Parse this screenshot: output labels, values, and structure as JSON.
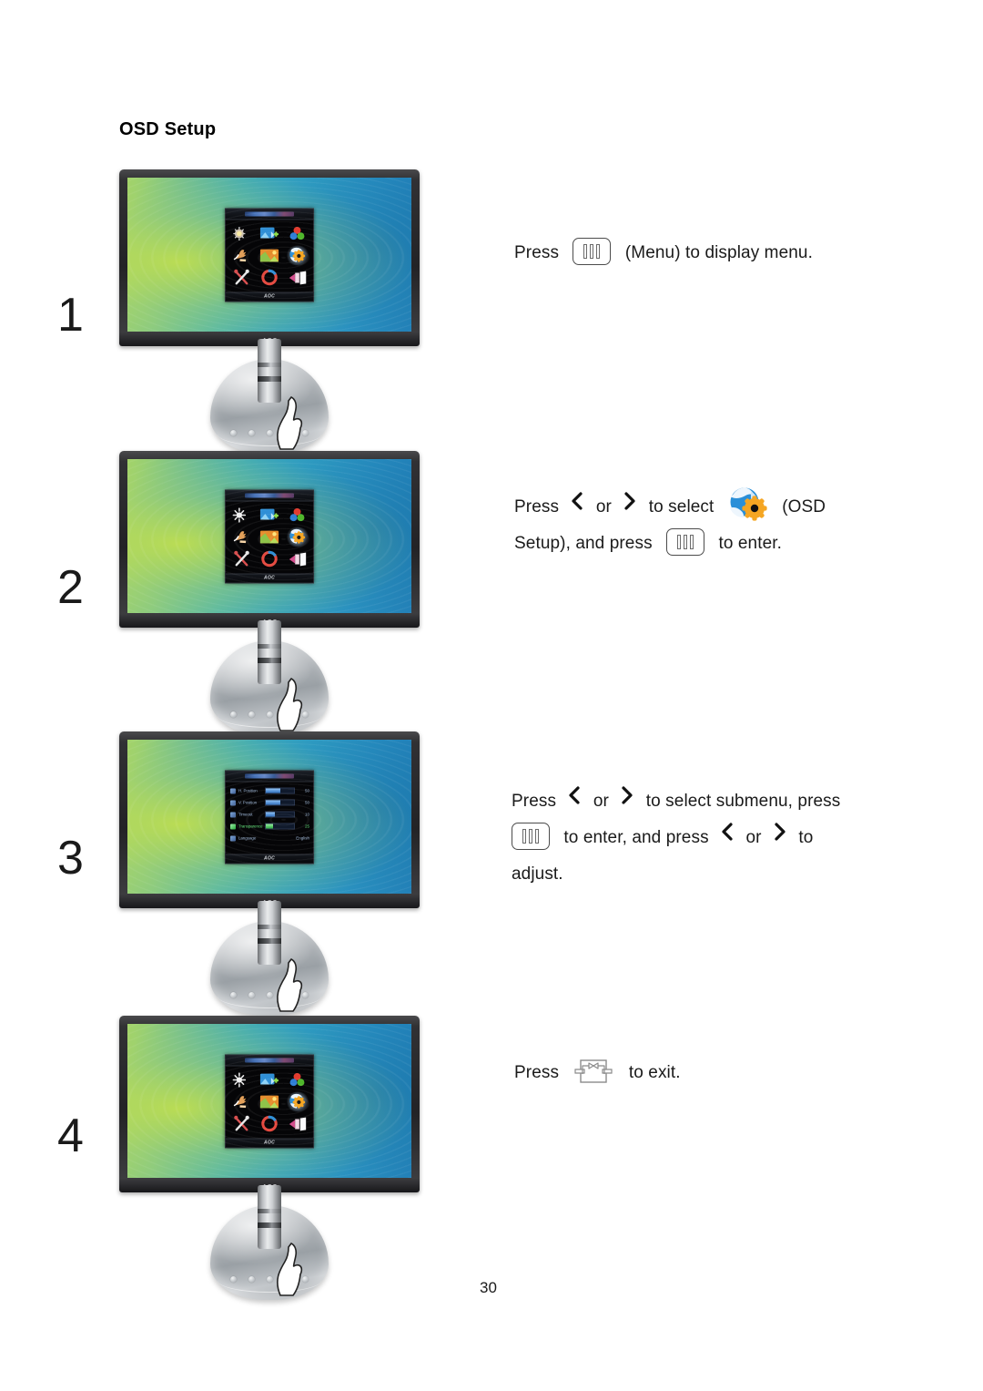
{
  "document": {
    "title": "OSD Setup",
    "page_number": "30"
  },
  "monitor": {
    "brand_logo": "AOC",
    "osd_logo": "AOC"
  },
  "osd_menu": {
    "icons": [
      {
        "name": "brightness-contrast-icon",
        "label": "Luminance"
      },
      {
        "name": "image-setup-icon",
        "label": "Image Setup"
      },
      {
        "name": "color-setup-icon",
        "label": "Color Setup"
      },
      {
        "name": "picture-boost-icon",
        "label": "Picture Boost"
      },
      {
        "name": "picture-in-picture-icon",
        "label": "PIP Setting"
      },
      {
        "name": "osd-setup-globe-gear-icon",
        "label": "OSD Setup"
      },
      {
        "name": "extra-tools-icon",
        "label": "Extra"
      },
      {
        "name": "reset-icon",
        "label": "Reset"
      },
      {
        "name": "exit-icon",
        "label": "Exit"
      }
    ],
    "submenu_rows": [
      {
        "label": "H. Position",
        "value": "50",
        "fill": 50,
        "active": false
      },
      {
        "label": "V. Position",
        "value": "50",
        "fill": 50,
        "active": false
      },
      {
        "label": "Timeout",
        "value": "10",
        "fill": 32,
        "active": false
      },
      {
        "label": "Transparence",
        "value": "25",
        "fill": 25,
        "active": true
      },
      {
        "label": "Language",
        "value": "English",
        "fill": 0,
        "active": false
      }
    ]
  },
  "steps": [
    {
      "number": "1",
      "lines": [
        {
          "parts": [
            {
              "type": "text",
              "value": "Press "
            },
            {
              "type": "key",
              "icon": "menu-key-icon"
            },
            {
              "type": "text",
              "value": " (Menu) to display menu."
            }
          ]
        }
      ]
    },
    {
      "number": "2",
      "lines": [
        {
          "parts": [
            {
              "type": "text",
              "value": "Press "
            },
            {
              "type": "chevron",
              "icon": "chevron-left-icon"
            },
            {
              "type": "text",
              "value": "or "
            },
            {
              "type": "chevron",
              "icon": "chevron-right-icon"
            },
            {
              "type": "text",
              "value": "to select "
            },
            {
              "type": "icon",
              "icon": "osd-setup-globe-gear-icon"
            },
            {
              "type": "text",
              "value": " (OSD"
            }
          ]
        },
        {
          "parts": [
            {
              "type": "text",
              "value": "Setup), and press "
            },
            {
              "type": "key",
              "icon": "menu-key-icon"
            },
            {
              "type": "text",
              "value": " to enter."
            }
          ]
        }
      ]
    },
    {
      "number": "3",
      "lines": [
        {
          "parts": [
            {
              "type": "text",
              "value": "Press "
            },
            {
              "type": "chevron",
              "icon": "chevron-left-icon"
            },
            {
              "type": "text",
              "value": "or "
            },
            {
              "type": "chevron",
              "icon": "chevron-right-icon"
            },
            {
              "type": "text",
              "value": "to select submenu, press"
            }
          ]
        },
        {
          "parts": [
            {
              "type": "key",
              "icon": "menu-key-icon"
            },
            {
              "type": "text",
              "value": " to enter, and press "
            },
            {
              "type": "chevron",
              "icon": "chevron-left-icon"
            },
            {
              "type": "text",
              "value": "or "
            },
            {
              "type": "chevron",
              "icon": "chevron-right-icon"
            },
            {
              "type": "text",
              "value": "to"
            }
          ]
        },
        {
          "parts": [
            {
              "type": "text",
              "value": "adjust."
            }
          ]
        }
      ]
    },
    {
      "number": "4",
      "lines": [
        {
          "parts": [
            {
              "type": "text",
              "value": "Press "
            },
            {
              "type": "key",
              "icon": "exit-key-icon"
            },
            {
              "type": "text",
              "value": " to exit."
            }
          ]
        }
      ]
    }
  ],
  "text": {
    "step1_line1_a": "Press",
    "step1_line1_b": "(Menu) to display menu.",
    "step2_line1_a": "Press",
    "step2_line1_or": "or",
    "step2_line1_b": "to select",
    "step2_line1_c": "(OSD",
    "step2_line2_a": "Setup), and press",
    "step2_line2_b": "to enter.",
    "step3_line1_a": "Press",
    "step3_line1_or": "or",
    "step3_line1_b": "to select submenu, press",
    "step3_line2_a": "to enter, and press",
    "step3_line2_or": "or",
    "step3_line2_b": "to",
    "step3_line3": "adjust.",
    "step4_a": "Press",
    "step4_b": "to exit."
  },
  "colors": {
    "screen_green": "#b9dc56",
    "screen_blue": "#1f6fb0",
    "osd_background": "#050507",
    "highlight_green": "#63e07a",
    "gear_orange": "#f5a623",
    "globe_blue": "#2a8fd8"
  }
}
